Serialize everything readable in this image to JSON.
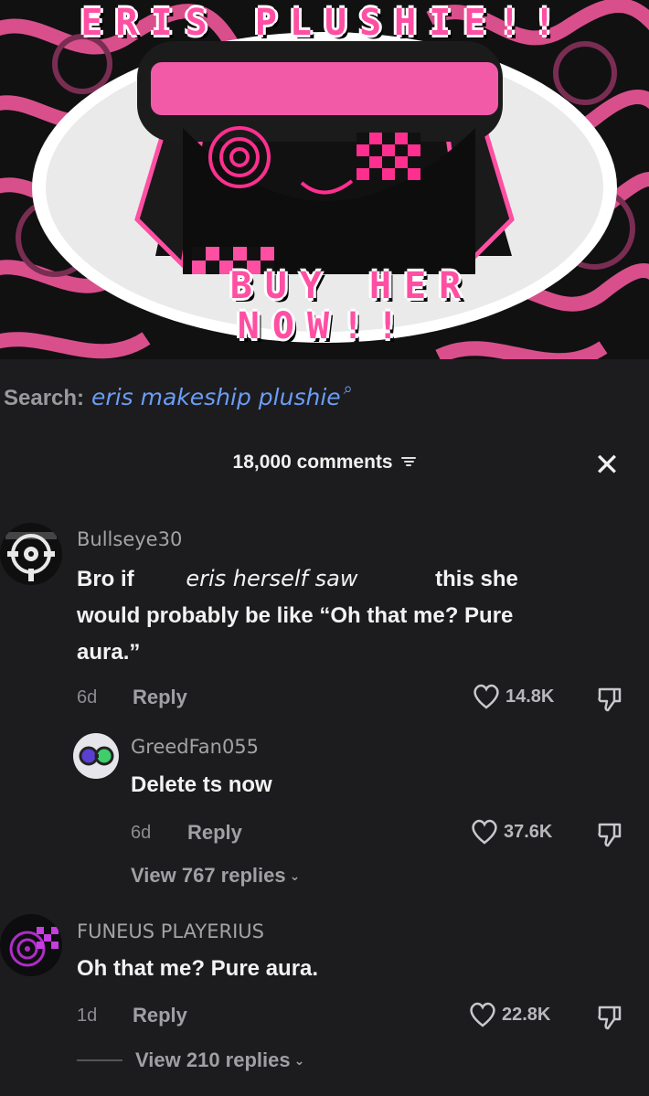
{
  "banner": {
    "title": "ERIS PLUSHIE!!",
    "cta_line1": "BUY HER",
    "cta_line2": "NOW!!",
    "accent_color": "#ff4fa3"
  },
  "search": {
    "label": "Search:",
    "query": "eris makeship plushie",
    "icon": "search-icon"
  },
  "comments_header": {
    "count_label": "18,000 comments",
    "filter_icon": "filter-icon",
    "close_icon": "close-icon"
  },
  "comments": [
    {
      "username": "Bullseye30",
      "text_part1": "Bro if",
      "text_hand": "eris herself saw",
      "text_part2": "this she",
      "text_line2": "would probably be like “Oh that me? Pure",
      "text_line3": "aura.”",
      "age": "6d",
      "reply_label": "Reply",
      "likes": "14.8K"
    },
    {
      "username": "GreedFan055",
      "text": "Delete ts now",
      "age": "6d",
      "reply_label": "Reply",
      "likes": "37.6K",
      "view_replies": "View 767 replies"
    },
    {
      "username": "FUNEUS PLAYERIUS",
      "text": "Oh that me? Pure aura.",
      "age": "1d",
      "reply_label": "Reply",
      "likes": "22.8K",
      "view_replies": "View 210 replies"
    }
  ]
}
